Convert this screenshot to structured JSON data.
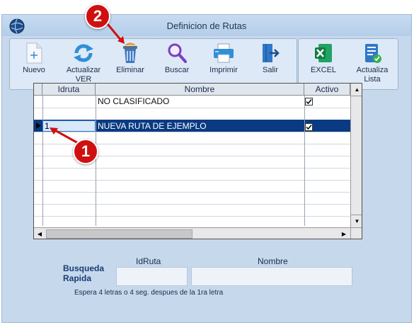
{
  "window": {
    "title": "Definicion de Rutas"
  },
  "toolbar": {
    "nuevo": "Nuevo",
    "actualizar_ver_1": "Actualizar",
    "actualizar_ver_2": "VER",
    "eliminar": "Eliminar",
    "buscar": "Buscar",
    "imprimir": "Imprimir",
    "salir": "Salir",
    "excel": "EXCEL",
    "actualiza_lista_1": "Actualiza",
    "actualiza_lista_2": "Lista"
  },
  "grid": {
    "columns": [
      "Idruta",
      "Nombre",
      "Activo"
    ],
    "rows": [
      {
        "idruta": "",
        "nombre": "NO CLASIFICADO",
        "activo": true,
        "selected": false
      },
      {
        "idruta": "1",
        "nombre": "NUEVA RUTA DE EJEMPLO",
        "activo": true,
        "selected": true
      }
    ]
  },
  "search": {
    "title_1": "Busqueda",
    "title_2": "Rapida",
    "idruta_label": "IdRuta",
    "nombre_label": "Nombre",
    "idruta_value": "",
    "nombre_value": "",
    "hint": "Espera 4 letras o 4 seg. despues de la 1ra letra"
  },
  "annotations": {
    "badge_1": "1",
    "badge_2": "2",
    "color": "#d01010"
  }
}
